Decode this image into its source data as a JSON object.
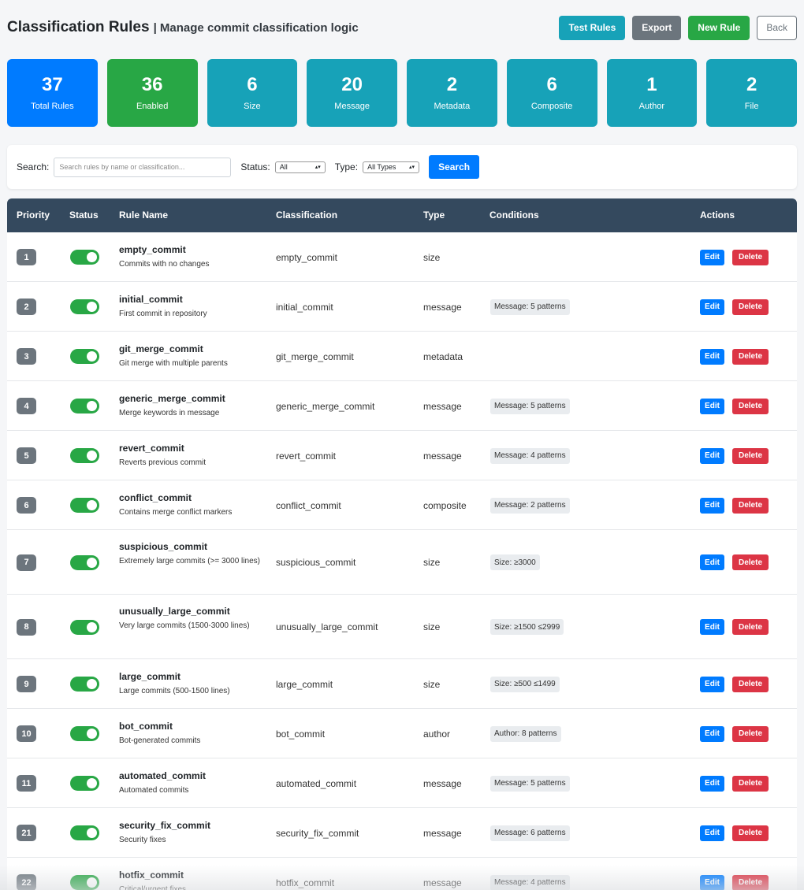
{
  "header": {
    "title": "Classification Rules",
    "subtitle": "| Manage commit classification logic",
    "buttons": {
      "test": "Test Rules",
      "export": "Export",
      "new": "New Rule",
      "back": "Back"
    }
  },
  "stats": [
    {
      "value": "37",
      "label": "Total Rules"
    },
    {
      "value": "36",
      "label": "Enabled"
    },
    {
      "value": "6",
      "label": "Size"
    },
    {
      "value": "20",
      "label": "Message"
    },
    {
      "value": "2",
      "label": "Metadata"
    },
    {
      "value": "6",
      "label": "Composite"
    },
    {
      "value": "1",
      "label": "Author"
    },
    {
      "value": "2",
      "label": "File"
    }
  ],
  "filters": {
    "search_label": "Search:",
    "search_placeholder": "Search rules by name or classification...",
    "status_label": "Status:",
    "status_value": "All",
    "type_label": "Type:",
    "type_value": "All Types",
    "search_button": "Search"
  },
  "table": {
    "columns": [
      "Priority",
      "Status",
      "Rule Name",
      "Classification",
      "Type",
      "Conditions",
      "Actions"
    ],
    "edit_label": "Edit",
    "delete_label": "Delete",
    "rows": [
      {
        "priority": "1",
        "enabled": true,
        "name": "empty_commit",
        "desc": "Commits with no changes",
        "classification": "empty_commit",
        "type": "size",
        "conditions": ""
      },
      {
        "priority": "2",
        "enabled": true,
        "name": "initial_commit",
        "desc": "First commit in repository",
        "classification": "initial_commit",
        "type": "message",
        "conditions": "Message: 5 patterns"
      },
      {
        "priority": "3",
        "enabled": true,
        "name": "git_merge_commit",
        "desc": "Git merge with multiple parents",
        "classification": "git_merge_commit",
        "type": "metadata",
        "conditions": ""
      },
      {
        "priority": "4",
        "enabled": true,
        "name": "generic_merge_commit",
        "desc": "Merge keywords in message",
        "classification": "generic_merge_commit",
        "type": "message",
        "conditions": "Message: 5 patterns"
      },
      {
        "priority": "5",
        "enabled": true,
        "name": "revert_commit",
        "desc": "Reverts previous commit",
        "classification": "revert_commit",
        "type": "message",
        "conditions": "Message: 4 patterns"
      },
      {
        "priority": "6",
        "enabled": true,
        "name": "conflict_commit",
        "desc": "Contains merge conflict markers",
        "classification": "conflict_commit",
        "type": "composite",
        "conditions": "Message: 2 patterns"
      },
      {
        "priority": "7",
        "enabled": true,
        "name": "suspicious_commit",
        "desc": "Extremely large commits (>= 3000 lines)",
        "classification": "suspicious_commit",
        "type": "size",
        "conditions": "Size: ≥3000"
      },
      {
        "priority": "8",
        "enabled": true,
        "name": "unusually_large_commit",
        "desc": "Very large commits (1500-3000 lines)",
        "classification": "unusually_large_commit",
        "type": "size",
        "conditions": "Size: ≥1500 ≤2999"
      },
      {
        "priority": "9",
        "enabled": true,
        "name": "large_commit",
        "desc": "Large commits (500-1500 lines)",
        "classification": "large_commit",
        "type": "size",
        "conditions": "Size: ≥500 ≤1499"
      },
      {
        "priority": "10",
        "enabled": true,
        "name": "bot_commit",
        "desc": "Bot-generated commits",
        "classification": "bot_commit",
        "type": "author",
        "conditions": "Author: 8 patterns"
      },
      {
        "priority": "11",
        "enabled": true,
        "name": "automated_commit",
        "desc": "Automated commits",
        "classification": "automated_commit",
        "type": "message",
        "conditions": "Message: 5 patterns"
      },
      {
        "priority": "21",
        "enabled": true,
        "name": "security_fix_commit",
        "desc": "Security fixes",
        "classification": "security_fix_commit",
        "type": "message",
        "conditions": "Message: 6 patterns"
      },
      {
        "priority": "22",
        "enabled": true,
        "name": "hotfix_commit",
        "desc": "Critical/urgent fixes",
        "classification": "hotfix_commit",
        "type": "message",
        "conditions": "Message: 4 patterns"
      }
    ]
  },
  "colors": {
    "primary": "#007bff",
    "success": "#28a745",
    "info": "#17a2b8",
    "secondary": "#6c757d",
    "danger": "#dc3545",
    "table_header": "#34495e"
  }
}
